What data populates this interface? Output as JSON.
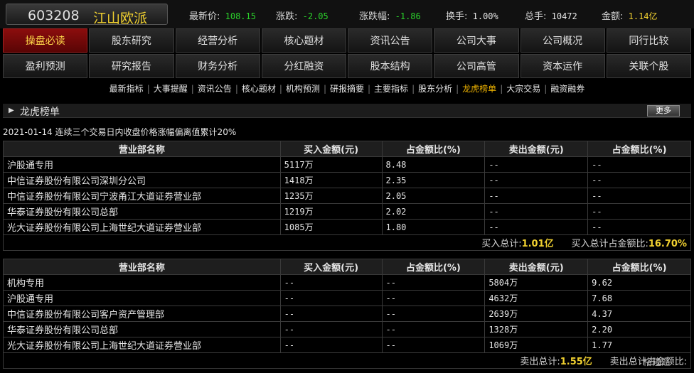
{
  "header": {
    "code": "603208",
    "name": "江山欧派",
    "quotes": [
      {
        "key": "最新价:",
        "value": "108.15",
        "color": "green"
      },
      {
        "key": "涨跌:",
        "value": "-2.05",
        "color": "green"
      },
      {
        "key": "涨跌幅:",
        "value": "-1.86",
        "color": "green"
      },
      {
        "key": "换手:",
        "value": "1.00%",
        "color": "white"
      },
      {
        "key": "总手:",
        "value": "10472",
        "color": "white"
      },
      {
        "key": "金额:",
        "value": "1.14亿",
        "color": "yellow"
      }
    ]
  },
  "nav_row1": [
    "操盘必读",
    "股东研究",
    "经营分析",
    "核心题材",
    "资讯公告",
    "公司大事",
    "公司概况",
    "同行比较"
  ],
  "nav_row2": [
    "盈利预测",
    "研究报告",
    "财务分析",
    "分红融资",
    "股本结构",
    "公司高管",
    "资本运作",
    "关联个股"
  ],
  "active_nav": "操盘必读",
  "sub_links": [
    "最新指标",
    "大事提醒",
    "资讯公告",
    "核心题材",
    "机构预测",
    "研报摘要",
    "主要指标",
    "股东分析",
    "龙虎榜单",
    "大宗交易",
    "融资融券"
  ],
  "active_sub": "龙虎榜单",
  "section": {
    "title": "龙虎榜单",
    "more": "更多"
  },
  "event": "2021-01-14 连续三个交易日内收盘价格涨幅偏离值累计20%",
  "columns": [
    "营业部名称",
    "买入金额(元)",
    "占金额比(%)",
    "卖出金额(元)",
    "占金额比(%)"
  ],
  "buy_rows": [
    [
      "沪股通专用",
      "5117万",
      "8.48",
      "--",
      "--"
    ],
    [
      "中信证券股份有限公司深圳分公司",
      "1418万",
      "2.35",
      "--",
      "--"
    ],
    [
      "中信证券股份有限公司宁波甬江大道证券营业部",
      "1235万",
      "2.05",
      "--",
      "--"
    ],
    [
      "华泰证券股份有限公司总部",
      "1219万",
      "2.02",
      "--",
      "--"
    ],
    [
      "光大证券股份有限公司上海世纪大道证券营业部",
      "1085万",
      "1.80",
      "--",
      "--"
    ]
  ],
  "buy_total": {
    "label1": "买入总计:",
    "value1": "1.01亿",
    "label2": "买入总计占金额比:",
    "value2": "16.70%"
  },
  "sell_rows": [
    [
      "机构专用",
      "--",
      "--",
      "5804万",
      "9.62"
    ],
    [
      "沪股通专用",
      "--",
      "--",
      "4632万",
      "7.68"
    ],
    [
      "中信证券股份有限公司客户资产管理部",
      "--",
      "--",
      "2639万",
      "4.37"
    ],
    [
      "华泰证券股份有限公司总部",
      "--",
      "--",
      "1328万",
      "2.20"
    ],
    [
      "光大证券股份有限公司上海世纪大道证券营业部",
      "--",
      "--",
      "1069万",
      "1.77"
    ]
  ],
  "sell_total": {
    "label1": "卖出总计:",
    "value1": "1.55亿",
    "label2": "卖出总计占金额比:",
    "value2": ""
  },
  "watermark": "格隆汇"
}
